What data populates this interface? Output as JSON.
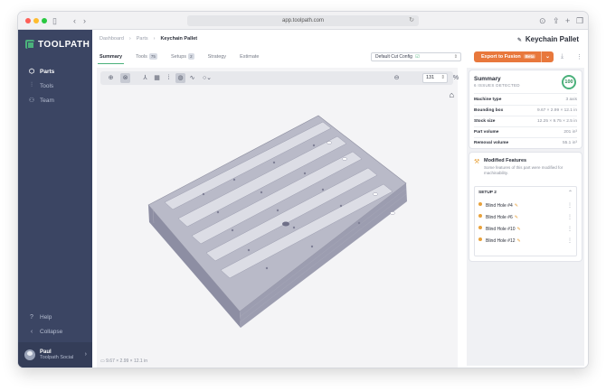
{
  "browser": {
    "url": "app.toolpath.com"
  },
  "sidebar": {
    "logo": "TOOLPATH",
    "items": [
      {
        "label": "Parts",
        "icon": "cube-icon"
      },
      {
        "label": "Tools",
        "icon": "tool-icon"
      },
      {
        "label": "Team",
        "icon": "team-icon"
      }
    ],
    "bottom": [
      {
        "label": "Help",
        "icon": "help-icon"
      },
      {
        "label": "Collapse",
        "icon": "collapse-icon"
      }
    ],
    "user": {
      "name": "Paul",
      "org": "Toolpath Social"
    }
  },
  "breadcrumb": [
    "Dashboard",
    "Parts",
    "Keychain Pallet"
  ],
  "page_title": "Keychain Pallet",
  "tabs": [
    {
      "label": "Summary",
      "badge": ""
    },
    {
      "label": "Tools",
      "badge": "75"
    },
    {
      "label": "Setups",
      "badge": "2"
    },
    {
      "label": "Strategy",
      "badge": ""
    },
    {
      "label": "Estimate",
      "badge": ""
    }
  ],
  "config_select": "Default Cut Config",
  "export_button": {
    "label": "Export to Fusion",
    "beta": "Beta"
  },
  "viewport": {
    "zoom": "131",
    "zoom_unit": "%",
    "dimensions": "9.67 × 2.99 × 12.1 in"
  },
  "summary": {
    "title": "Summary",
    "subtitle": "6 ISSUES DETECTED",
    "score": "100",
    "rows": [
      {
        "key": "Machine type",
        "value": "3 axis"
      },
      {
        "key": "Bounding box",
        "value": "9.67 × 2.99 × 12.1 in"
      },
      {
        "key": "Stock size",
        "value": "12.25 × 9.75 × 2.5 in"
      },
      {
        "key": "Part volume",
        "value": "201 in³"
      },
      {
        "key": "Removal volume",
        "value": "55.1 in³"
      }
    ]
  },
  "modified_features": {
    "title": "Modified Features",
    "description": "Some features of this part were modified for machinability.",
    "setup": "SETUP 2",
    "items": [
      "Blind Hole #4",
      "Blind Hole #6",
      "Blind Hole #10",
      "Blind Hole #12"
    ]
  },
  "colors": {
    "accent": "#4bb17b",
    "sidebar": "#3b4563",
    "export": "#e8783c",
    "warning": "#e8a23c"
  }
}
